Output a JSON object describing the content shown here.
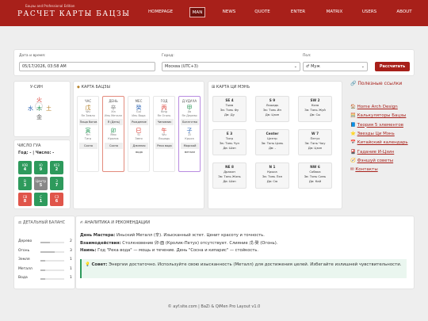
{
  "header": {
    "subtitle": "Бацзы and Professional Edition",
    "logo": "РАСЧЕТ КАРТЫ БАЦЗЫ",
    "nav": [
      "HOMEPAGE",
      "MAN",
      "NEWS",
      "QUOTE",
      "ENTER",
      "MATRIX",
      "USERS",
      "ABOUT"
    ],
    "active_nav": "MAN"
  },
  "form": {
    "datetime_label": "Дата и время:",
    "datetime_value": "05/17/2026, 03:58 AM",
    "city_label": "Город:",
    "city_value": "Москва (UTC+3)",
    "gender_label": "Пол:",
    "gender_value": "♂ Муж",
    "submit": "Рассчитать"
  },
  "uxing": {
    "title": "У-СИН",
    "fire": "火",
    "wood": "木",
    "water": "水",
    "earth": "土",
    "metal": "金"
  },
  "gua": {
    "title": "ЧИСЛО ГУА",
    "year_line": "Год: - | Число: -",
    "cells": [
      {
        "label": "ЮВ",
        "num": "4"
      },
      {
        "label": "Ю",
        "num": "9"
      },
      {
        "label": "ЮЗ",
        "num": "2"
      },
      {
        "label": "В",
        "num": "3"
      },
      {
        "label": "Центр",
        "num": "5"
      },
      {
        "label": "З",
        "num": "7"
      },
      {
        "label": "СВ",
        "num": "8"
      },
      {
        "label": "С",
        "num": "1"
      },
      {
        "label": "СЗ",
        "num": "6"
      }
    ]
  },
  "bazi": {
    "title": "КАРТА БАЦЗЫ",
    "pillars": [
      {
        "head": "ЧАС",
        "stem": "戊",
        "stem_tr": "Wu",
        "sub1": "Ян Земля",
        "god": "Пища богов",
        "branch": "寅",
        "branch_tr": "Yin",
        "sub2": "Тигр",
        "bot": "Сосна"
      },
      {
        "head": "ДЕНЬ",
        "stem": "辛",
        "stem_tr": "Xin",
        "sub1": "Инь Металл",
        "god": "Я (День)",
        "branch": "卯",
        "branch_tr": "Mao",
        "sub2": "Кролик",
        "bot": "Сосна"
      },
      {
        "head": "МЕС",
        "stem": "癸",
        "stem_tr": "Gui",
        "sub1": "Инь Вода",
        "god": "Рождение",
        "branch": "巳",
        "branch_tr": "Si",
        "sub2": "Змея",
        "bot": "Длинная вода"
      },
      {
        "head": "ГОД",
        "stem": "丙",
        "stem_tr": "Bing",
        "sub1": "Ян Огонь",
        "god": "Чиновник",
        "branch": "午",
        "branch_tr": "Wu",
        "sub2": "Лошадь",
        "bot": "Река вода"
      },
      {
        "head": "Д.УДАЧА",
        "stem": "甲",
        "stem_tr": "Jia",
        "sub1": "Ян Дерево",
        "god": "Богатство",
        "branch": "子",
        "branch_tr": "Zi",
        "sub2": "Крыса",
        "bot": "Морской металл"
      }
    ]
  },
  "qimen": {
    "title": "КАРТА ЦИ МЭНЬ",
    "cells": [
      {
        "dir": "SE 4",
        "l1": "Тьма",
        "l2": "Зв: Тянь Фу",
        "l3": "Дв: Ду"
      },
      {
        "dir": "S 9",
        "l1": "Лошадь",
        "l2": "Зв: Тянь Ин",
        "l3": "Дв: Цзин"
      },
      {
        "dir": "SW 2",
        "l1": "Коза",
        "l2": "Зв: Тянь Жуй",
        "l3": "Дв: Сы"
      },
      {
        "dir": "E 3",
        "l1": "Тигр",
        "l2": "Зв: Тянь Чун",
        "l3": "Дв: Шэн"
      },
      {
        "dir": "Center",
        "l1": "Центр",
        "l2": "Зв: Тянь Цинь",
        "l3": "Дв: -"
      },
      {
        "dir": "W 7",
        "l1": "Петух",
        "l2": "Зв: Тянь Чжу",
        "l3": "Дв: Цзин"
      },
      {
        "dir": "NE 8",
        "l1": "Дракон",
        "l2": "Зв: Тянь Жэнь",
        "l3": "Дв: Шэн"
      },
      {
        "dir": "N 1",
        "l1": "Крыса",
        "l2": "Зв: Тянь Пэн",
        "l3": "Дв: Сю"
      },
      {
        "dir": "NW 6",
        "l1": "Собака",
        "l2": "Зв: Тянь Синь",
        "l3": "Дв: Кай"
      }
    ]
  },
  "links": {
    "title": "Полезные ссылки",
    "items": [
      "Home Arch Design",
      "Калькуляторы Бацзы",
      "Теория 5 элементов",
      "Звезды Ци Мэнь",
      "Китайский календарь",
      "Гадание И-Цзин",
      "Фэншуй советы",
      "Контакты"
    ]
  },
  "balance": {
    "title": "ДЕТАЛЬНЫЙ БАЛАНС",
    "rows": [
      {
        "name": "Дерево",
        "value": 2
      },
      {
        "name": "Огонь",
        "value": 3
      },
      {
        "name": "Земля",
        "value": 1
      },
      {
        "name": "Металл",
        "value": 1
      },
      {
        "name": "Вода",
        "value": 1
      }
    ],
    "max": 5
  },
  "analysis": {
    "title": "АНАЛИТИКА И РЕКОМЕНДАЦИИ",
    "l1_b": "День Мастера:",
    "l1": " Иньский Металл (辛). Изысканный эстет. Ценит красоту и точность.",
    "l2_b": "Взаимодействия:",
    "l2": " Столкновение 卯-酉 (Кролик-Петух) отсутствует. Слияние 戊-癸 (Огонь).",
    "l3_b": "Наинь:",
    "l3": " Год \"Река вода\" — мощь и течение. День \"Сосна и кипарис\" — стойкость.",
    "tip_b": "Совет:",
    "tip": " Энергии достаточно. Используйте свою изысканность (Металл) для достижения целей. Избегайте излишней чувствительности."
  },
  "footer": "© ayf.site.com | BaZi & QiMen Pro Layout v1.0",
  "colors": {
    "brand": "#a8201a",
    "gua_green": "#2e9a5c",
    "gua_red": "#e0554a",
    "gua_gray": "#888888"
  }
}
